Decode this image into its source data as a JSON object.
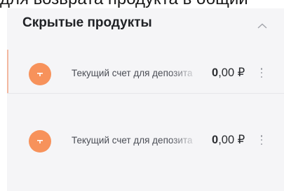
{
  "top_text": "для возврата продукта в общий",
  "hidden_products": {
    "title": "Скрытые продукты",
    "collapse_icon": "chevron-up-icon",
    "items": [
      {
        "icon": "deposit-icon",
        "icon_color": "#f7925b",
        "name": "Текущий счет для депозита",
        "amount_whole": "0",
        "amount_fraction": ",00",
        "currency": "₽",
        "menu_icon": "more-vertical-icon"
      },
      {
        "icon": "deposit-icon",
        "icon_color": "#f7925b",
        "name": "Текущий счет для депозита",
        "amount_whole": "0",
        "amount_fraction": ",00",
        "currency": "₽",
        "menu_icon": "more-vertical-icon"
      }
    ]
  }
}
